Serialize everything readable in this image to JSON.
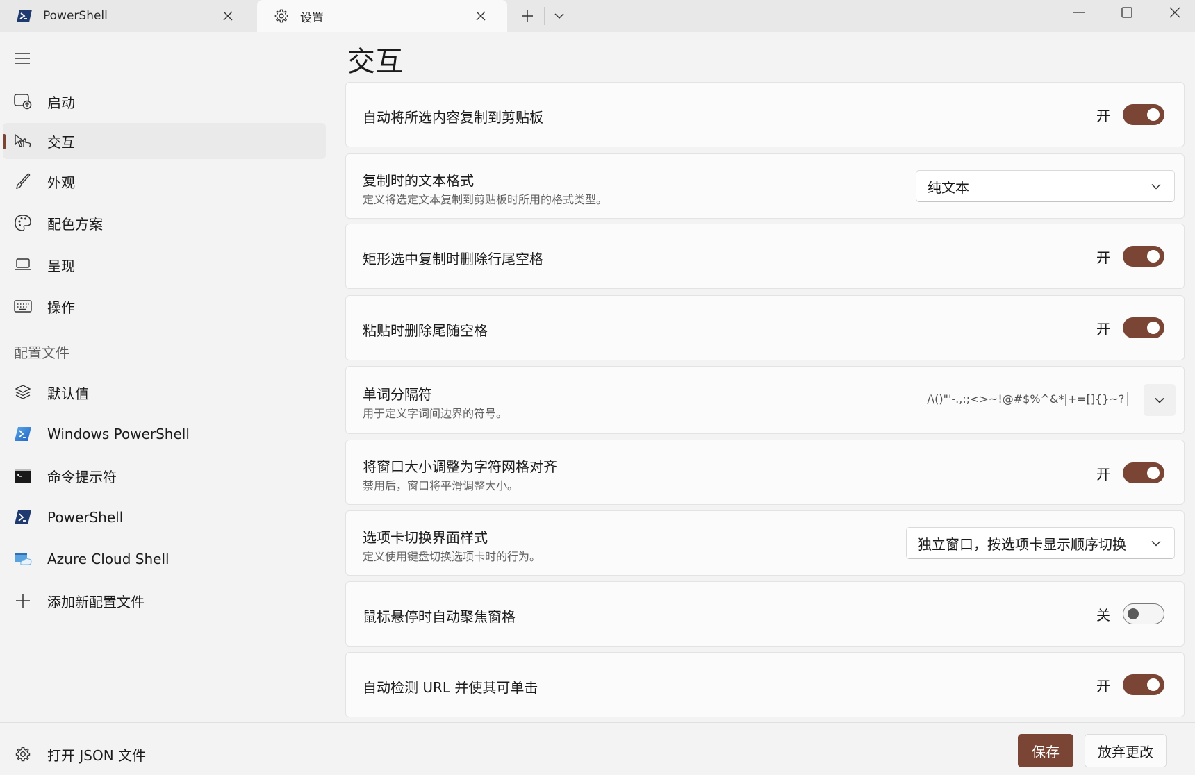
{
  "tabs": [
    {
      "label": "PowerShell",
      "icon": "powershell-icon",
      "active": false
    },
    {
      "label": "设置",
      "icon": "gear-icon",
      "active": true
    }
  ],
  "sidebar": {
    "nav": [
      {
        "label": "启动",
        "icon": "launch-icon"
      },
      {
        "label": "交互",
        "icon": "interaction-icon",
        "selected": true
      },
      {
        "label": "外观",
        "icon": "brush-icon"
      },
      {
        "label": "配色方案",
        "icon": "palette-icon"
      },
      {
        "label": "呈现",
        "icon": "laptop-icon"
      },
      {
        "label": "操作",
        "icon": "keyboard-icon"
      }
    ],
    "profiles_header": "配置文件",
    "profiles": [
      {
        "label": "默认值",
        "icon": "layers-icon"
      },
      {
        "label": "Windows PowerShell",
        "icon": "powershell-icon"
      },
      {
        "label": "命令提示符",
        "icon": "cmd-icon"
      },
      {
        "label": "PowerShell",
        "icon": "powershell-dark-icon"
      },
      {
        "label": "Azure Cloud Shell",
        "icon": "azure-icon"
      },
      {
        "label": "添加新配置文件",
        "icon": "plus-icon"
      }
    ],
    "open_json": "打开 JSON 文件"
  },
  "main": {
    "title": "交互",
    "settings": [
      {
        "title": "自动将所选内容复制到剪贴板",
        "type": "toggle",
        "state": "开"
      },
      {
        "title": "复制时的文本格式",
        "desc": "定义将选定文本复制到剪贴板时所用的格式类型。",
        "type": "dropdown",
        "value": "纯文本"
      },
      {
        "title": "矩形选中复制时删除行尾空格",
        "type": "toggle",
        "state": "开"
      },
      {
        "title": "粘贴时删除尾随空格",
        "type": "toggle",
        "state": "开"
      },
      {
        "title": "单词分隔符",
        "desc": "用于定义字词间边界的符号。",
        "type": "text",
        "value": "/\\()\"'-.,:;<>~!@#$%^&*|+=[]{}~?│"
      },
      {
        "title": "将窗口大小调整为字符网格对齐",
        "desc": "禁用后，窗口将平滑调整大小。",
        "type": "toggle",
        "state": "开"
      },
      {
        "title": "选项卡切换界面样式",
        "desc": "定义使用键盘切换选项卡时的行为。",
        "type": "dropdown",
        "value": "独立窗口，按选项卡显示顺序切换"
      },
      {
        "title": "鼠标悬停时自动聚焦窗格",
        "type": "toggle",
        "state": "关"
      },
      {
        "title": "自动检测 URL 并使其可单击",
        "type": "toggle",
        "state": "开"
      }
    ]
  },
  "footer": {
    "save": "保存",
    "discard": "放弃更改"
  },
  "colors": {
    "accent": "#7a4535",
    "background": "#f3f3f3",
    "card": "#fbfbfb"
  }
}
